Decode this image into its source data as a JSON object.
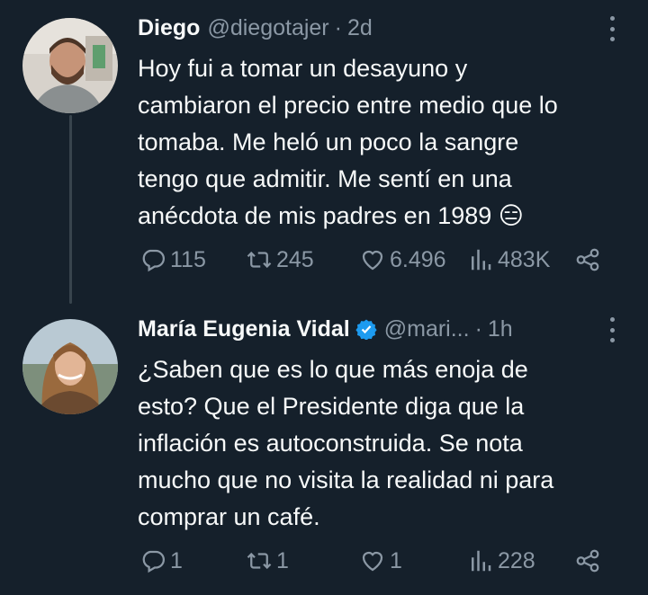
{
  "tweets": [
    {
      "name": "Diego",
      "handle": "@diegotajer",
      "dot": "·",
      "time": "2d",
      "text": "Hoy fui a tomar un desayuno y\ncambiaron el precio entre medio que lo\ntomaba. Me heló un poco la sangre\ntengo que admitir. Me sentí en una\nanécdota de mis padres en 1989 😑",
      "replies": "115",
      "retweets": "245",
      "likes": "6.496",
      "views": "483K"
    },
    {
      "name": "María Eugenia Vidal",
      "handle": "@mari...",
      "dot": "·",
      "time": "1h",
      "text": "¿Saben que es lo que más enoja de\nesto? Que el Presidente diga que la\ninflación es autoconstruida. Se nota\nmucho que no visita la realidad ni para\ncomprar un café.",
      "replies": "1",
      "retweets": "1",
      "likes": "1",
      "views": "228"
    }
  ],
  "colors": {
    "background": "#15202b",
    "text": "#f7f9f9",
    "secondary": "#8b98a5",
    "verified": "#1d9bf0",
    "thread_line": "#38444d"
  },
  "icons": [
    "reply-icon",
    "retweet-icon",
    "like-icon",
    "views-icon",
    "share-icon",
    "more-icon",
    "verified-badge-icon"
  ]
}
